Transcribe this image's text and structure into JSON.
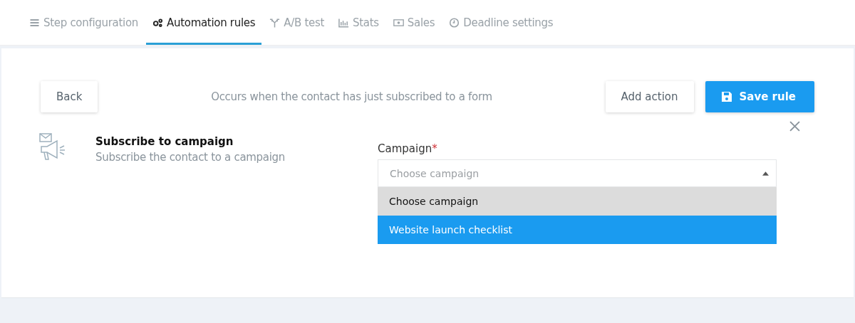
{
  "tabs": [
    {
      "label": "Step configuration",
      "selected": false
    },
    {
      "label": "Automation rules",
      "selected": true
    },
    {
      "label": "A/B test",
      "selected": false
    },
    {
      "label": "Stats",
      "selected": false
    },
    {
      "label": "Sales",
      "selected": false
    },
    {
      "label": "Deadline settings",
      "selected": false
    }
  ],
  "toolbar": {
    "back": "Back",
    "trigger": "Occurs when the contact has just subscribed to a form",
    "add_action": "Add action",
    "save": "Save rule"
  },
  "action": {
    "title": "Subscribe to campaign",
    "description": "Subscribe the contact to a campaign"
  },
  "campaign_field": {
    "label": "Campaign",
    "required_mark": "*",
    "placeholder": "Choose campaign",
    "expanded": true,
    "options": [
      {
        "label": "Choose campaign",
        "current": true,
        "selected": false
      },
      {
        "label": "Website launch checklist",
        "current": false,
        "selected": true
      }
    ]
  }
}
